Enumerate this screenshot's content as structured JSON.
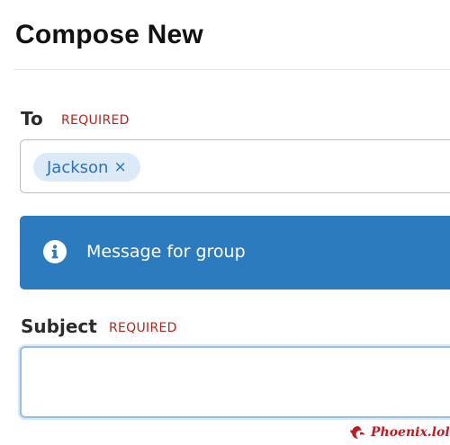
{
  "page": {
    "title": "Compose New"
  },
  "to_field": {
    "label": "To",
    "required_text": "REQUIRED",
    "recipients": [
      {
        "name": "Jackson",
        "remove_symbol": "×"
      }
    ]
  },
  "info_banner": {
    "icon": "info-icon",
    "message": "Message for group"
  },
  "subject_field": {
    "label": "Subject",
    "required_text": "REQUIRED",
    "value": ""
  },
  "watermark": {
    "text": "Phoenix.lol",
    "icon": "phoenix-logo-icon"
  },
  "colors": {
    "accent_blue": "#2b7bbe",
    "chip_bg": "#dce9f6",
    "chip_text": "#2a71b8",
    "required_red": "#b3261e"
  }
}
